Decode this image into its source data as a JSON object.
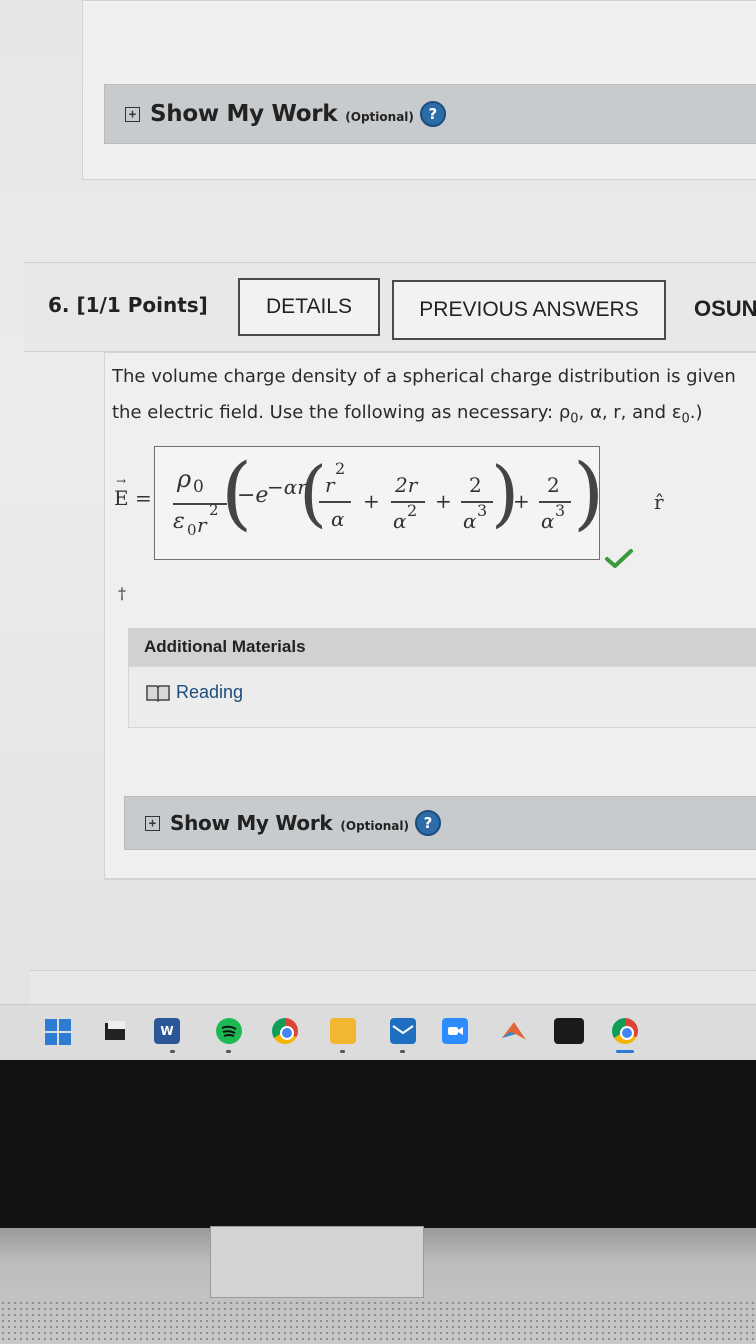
{
  "top_section": {
    "show_my_work": {
      "title": "Show My Work",
      "optional": "(Optional)",
      "help": "?"
    }
  },
  "question": {
    "number": "6.",
    "points": "[1/1 Points]",
    "details_button": "DETAILS",
    "previous_answers_button": "PREVIOUS ANSWERS",
    "publisher_tag": "OSUN",
    "text_line1": "The volume charge density of a spherical charge distribution is given",
    "text_line2": "the electric field. Use the following as necessary: ρ",
    "text_line2_vars": ", α, r, and ε",
    "text_line2_end": ".)",
    "subscript_zero": "0"
  },
  "answer": {
    "lhs": "E =",
    "rho": "ρ",
    "eps": "ε",
    "sub0": "0",
    "r": "r",
    "sup2": "2",
    "minus_e": "−e",
    "exponent": "−αr",
    "alpha": "α",
    "plus": "+",
    "two_r": "2r",
    "two": "2",
    "sup3": "3",
    "rhat": "r̂",
    "dagger": "†"
  },
  "additional_materials": {
    "title": "Additional Materials",
    "reading_link": "Reading"
  },
  "bottom_section": {
    "show_my_work": {
      "title": "Show My Work",
      "optional": "(Optional)",
      "help": "?"
    }
  },
  "taskbar": {
    "icons": [
      "windows-start-icon",
      "file-explorer-icon",
      "word-icon",
      "spotify-icon",
      "chrome-icon",
      "folder-icon",
      "mail-icon",
      "zoom-icon",
      "matlab-icon",
      "terminal-icon",
      "chrome-icon"
    ]
  },
  "colors": {
    "help_blue": "#2d6ca8",
    "check_green": "#3a9a3a",
    "link_blue": "#1c4c7c"
  }
}
